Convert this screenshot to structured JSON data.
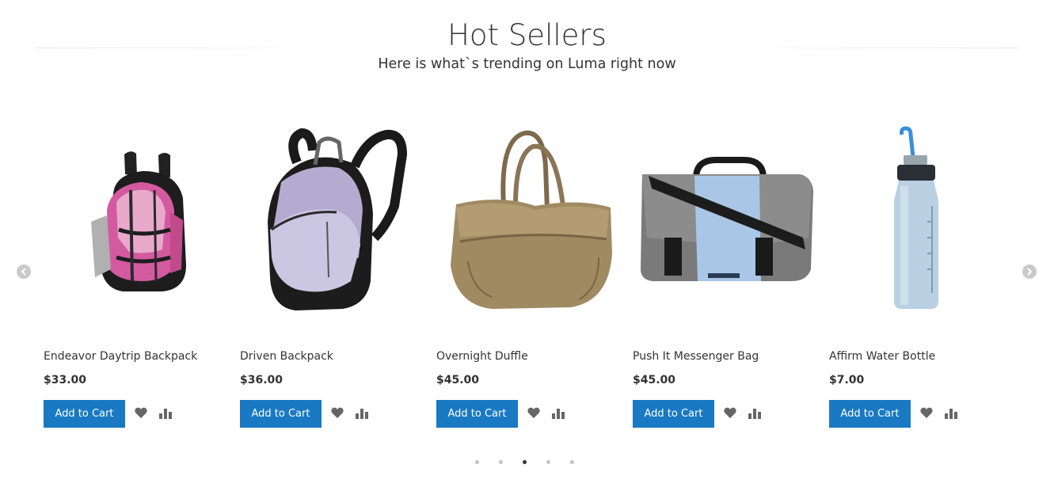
{
  "section": {
    "title": "Hot Sellers",
    "subtitle": "Here is what`s trending on Luma right now"
  },
  "carousel": {
    "active_dot": 2,
    "dot_count": 5
  },
  "products": [
    {
      "name": "Endeavor Daytrip Backpack",
      "price": "$33.00",
      "add_to_cart": "Add to Cart",
      "image": "pink-black-backpack-image"
    },
    {
      "name": "Driven Backpack",
      "price": "$36.00",
      "add_to_cart": "Add to Cart",
      "image": "lavender-black-backpack-image"
    },
    {
      "name": "Overnight Duffle",
      "price": "$45.00",
      "add_to_cart": "Add to Cart",
      "image": "tan-duffle-bag-image"
    },
    {
      "name": "Push It Messenger Bag",
      "price": "$45.00",
      "add_to_cart": "Add to Cart",
      "image": "gray-blue-messenger-bag-image"
    },
    {
      "name": "Affirm Water Bottle",
      "price": "$7.00",
      "add_to_cart": "Add to Cart",
      "image": "blue-water-bottle-image"
    }
  ],
  "colors": {
    "button": "#1979c3",
    "button_text": "#ffffff",
    "icon": "#666666",
    "arrow": "#c9c9c9",
    "dot": "#c2c2c2",
    "dot_active": "#333333"
  },
  "icons": {
    "prev": "chevron-left-icon",
    "next": "chevron-right-icon",
    "wishlist": "heart-icon",
    "compare": "bar-chart-icon"
  }
}
